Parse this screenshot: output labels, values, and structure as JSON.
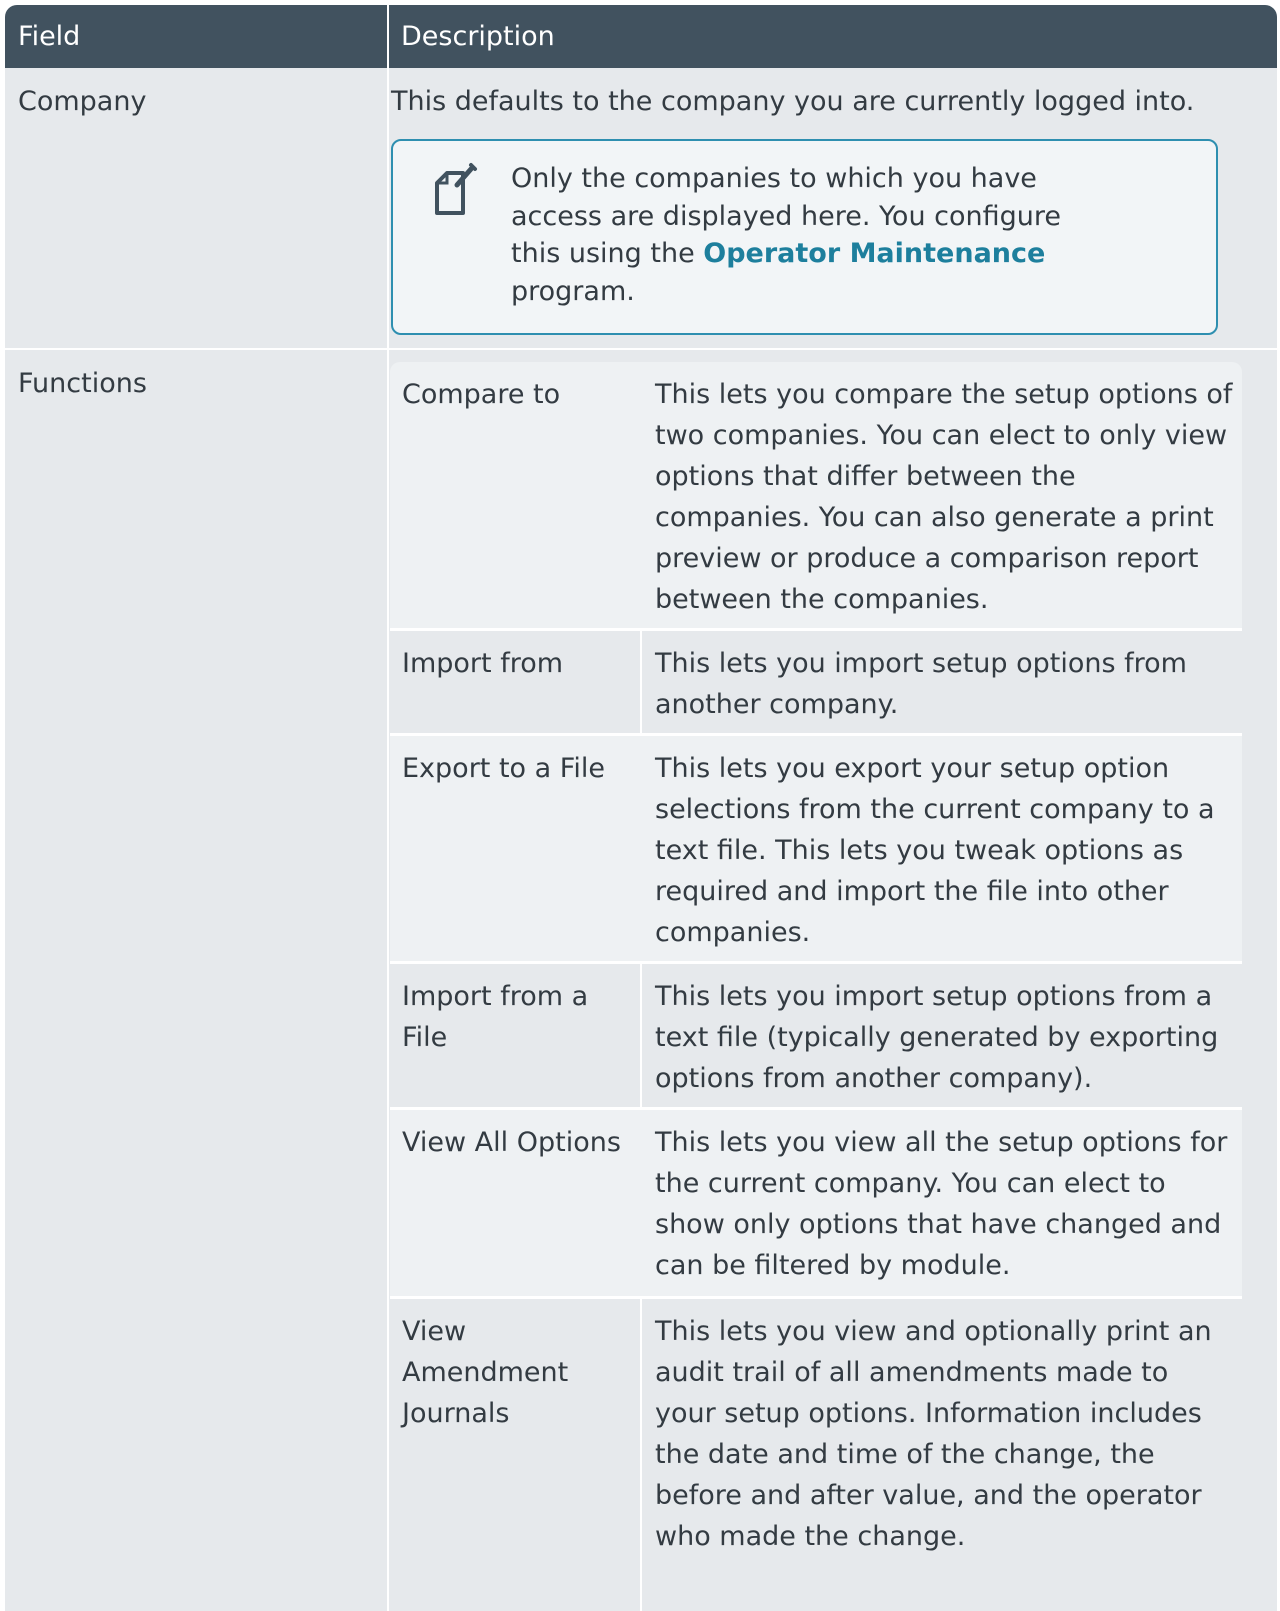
{
  "header": {
    "field": "Field",
    "description": "Description"
  },
  "rows": [
    {
      "field": "Company",
      "description": "This defaults to the company you are currently logged into.",
      "note": {
        "icon": "note-pencil-icon",
        "line1": "Only the companies to which you have",
        "line2": "access are displayed here. You configure",
        "line3_prefix": "this using the ",
        "link": "Operator Maintenance",
        "line4": "program."
      }
    },
    {
      "field": "Functions",
      "functions": [
        {
          "name": "Compare to",
          "lines": [
            "This lets you compare the setup options of",
            "two companies. You can elect to only view",
            "options that differ between the",
            "companies. You can also generate a print",
            "preview or produce a comparison report",
            "between the companies."
          ]
        },
        {
          "name": "Import from",
          "lines": [
            "This lets you import setup options from",
            "another company."
          ]
        },
        {
          "name": "Export to a File",
          "lines": [
            "This lets you export your setup option",
            "selections from the current company to a",
            "text file. This lets you tweak options as",
            "required and import the file into other",
            "companies."
          ]
        },
        {
          "name_lines": [
            "Import from a",
            "File"
          ],
          "lines": [
            "This lets you import setup options from a",
            "text file (typically generated by exporting",
            "options from another company)."
          ]
        },
        {
          "name": "View All Options",
          "lines": [
            "This lets you view all the setup options for",
            "the current company. You can elect to",
            "show only options that have changed and",
            "can be filtered by module."
          ]
        },
        {
          "name_lines": [
            "View",
            "Amendment",
            "Journals"
          ],
          "lines": [
            "This lets you view and optionally print an",
            "audit trail of all amendments made to",
            "your setup options. Information includes",
            "the date and time of the change, the",
            "before and after value, and the operator",
            "who made the change."
          ]
        }
      ]
    }
  ]
}
